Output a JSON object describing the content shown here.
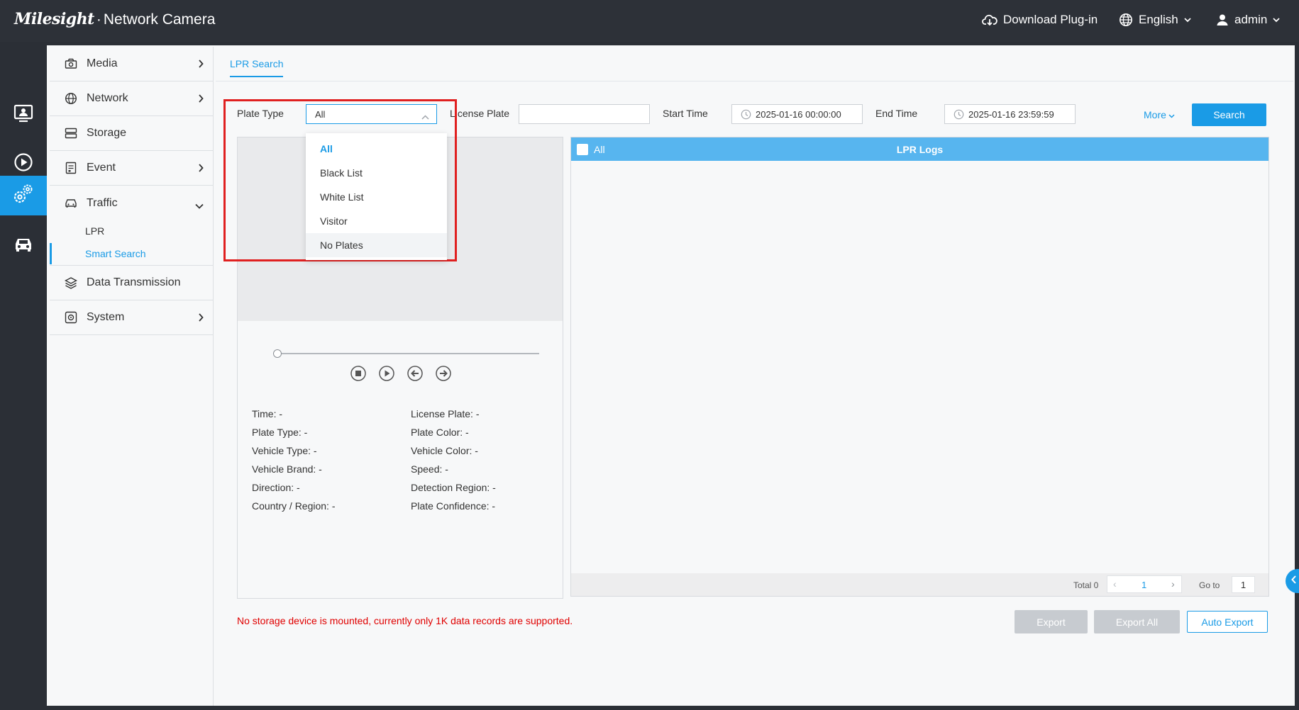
{
  "header": {
    "brand_logo": "Milesight",
    "brand_separator": "·",
    "brand_product": "Network Camera",
    "download_label": "Download Plug-in",
    "language_label": "English",
    "user_label": "admin"
  },
  "rail": {
    "items": [
      {
        "icon": "live-view-icon"
      },
      {
        "icon": "playback-icon"
      },
      {
        "icon": "settings-icon",
        "active": true
      },
      {
        "icon": "vehicle-icon"
      }
    ]
  },
  "sidenav": {
    "media": "Media",
    "network": "Network",
    "storage": "Storage",
    "event": "Event",
    "traffic": "Traffic",
    "traffic_lpr": "LPR",
    "traffic_smart_search": "Smart Search",
    "data_transmission": "Data Transmission",
    "system": "System"
  },
  "main": {
    "tab_label": "LPR Search",
    "filters": {
      "plate_type_label": "Plate Type",
      "plate_type_value": "All",
      "license_plate_label": "License Plate",
      "license_plate_value": "",
      "start_time_label": "Start Time",
      "start_time_value": "2025-01-16 00:00:00",
      "end_time_label": "End Time",
      "end_time_value": "2025-01-16 23:59:59",
      "more_label": "More",
      "search_label": "Search"
    },
    "plate_type_options": [
      "All",
      "Black List",
      "White List",
      "Visitor",
      "No Plates"
    ],
    "details": {
      "time": "Time: -",
      "plate_type": "Plate Type: -",
      "vehicle_type": "Vehicle Type: -",
      "vehicle_brand": "Vehicle Brand: -",
      "direction": "Direction: -",
      "country_region": "Country / Region: -",
      "license_plate": "License Plate: -",
      "plate_color": "Plate Color: -",
      "vehicle_color": "Vehicle Color: -",
      "speed": "Speed: -",
      "detection_region": "Detection Region: -",
      "plate_confidence": "Plate Confidence: -"
    },
    "logs": {
      "select_all_label": "All",
      "title": "LPR Logs",
      "total_label": "Total 0",
      "current_page": "1",
      "goto_label": "Go to",
      "goto_value": "1"
    },
    "warning": "No storage device is mounted, currently only 1K data records are supported.",
    "export_label": "Export",
    "export_all_label": "Export All",
    "auto_export_label": "Auto Export"
  },
  "colors": {
    "accent": "#1a9be6",
    "header_bg": "#2d3138",
    "logs_header": "#57b5ef",
    "warning": "#e00000",
    "highlight": "#e02020"
  }
}
